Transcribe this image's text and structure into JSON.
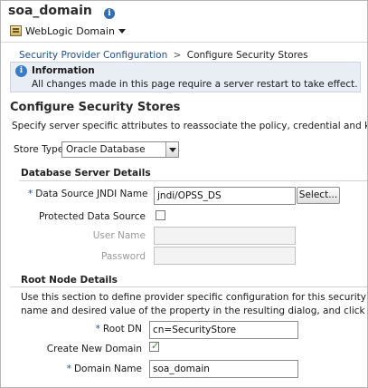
{
  "header": {
    "domain_name": "soa_domain",
    "menu_label": "WebLogic Domain",
    "info_icon": "info-icon",
    "menu_icon": "weblogic-domain-icon"
  },
  "breadcrumb": {
    "parent": "Security Provider Configuration",
    "separator": ">",
    "current": "Configure Security Stores"
  },
  "info_banner": {
    "icon": "info-icon",
    "title": "Information",
    "message": "All changes made in this page require a server restart to take effect."
  },
  "page": {
    "title": "Configure Security Stores",
    "description": "Specify server specific attributes to reassociate the policy, credential and key stores."
  },
  "store_type": {
    "label": "Store Type",
    "value": "Oracle Database"
  },
  "db_section": {
    "heading": "Database Server Details",
    "jndi_label": "Data Source JNDI Name",
    "jndi_value": "jndi/OPSS_DS",
    "select_button": "Select...",
    "protected_label": "Protected Data Source",
    "protected_checked": false,
    "user_label": "User Name",
    "user_value": "",
    "password_label": "Password",
    "password_value": ""
  },
  "root_section": {
    "heading": "Root Node Details",
    "description_line1": "Use this section to define provider specific configuration for this security store. To speci",
    "description_line2": "name and desired value of the property in the resulting dialog, and click OK.",
    "root_dn_label": "Root DN",
    "root_dn_value": "cn=SecurityStore",
    "create_domain_label": "Create New Domain",
    "create_domain_checked": true,
    "domain_name_label": "Domain Name",
    "domain_name_value": "soa_domain"
  },
  "required_marker": "*"
}
